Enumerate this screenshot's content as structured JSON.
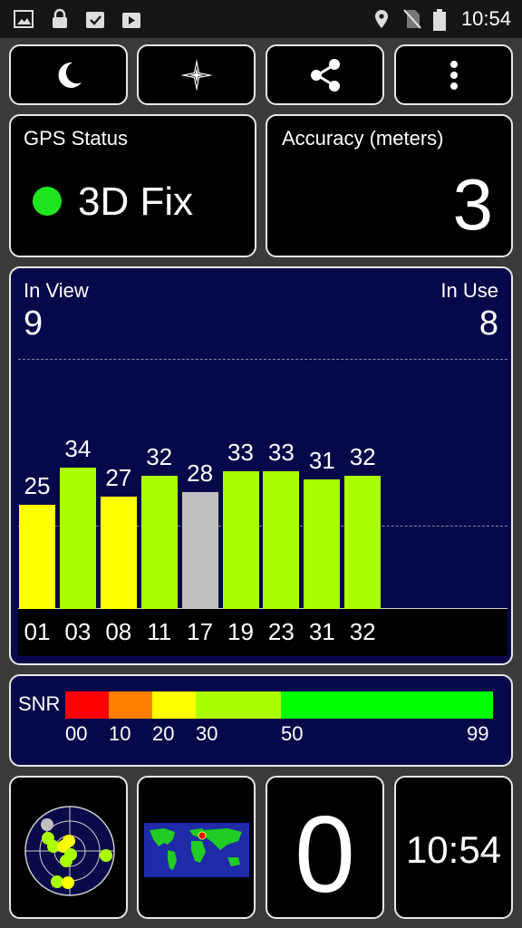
{
  "statusbar": {
    "time": "10:54",
    "icons": [
      "image-icon",
      "lock-icon",
      "clipboard-check-icon",
      "play-store-icon",
      "location-pin-icon",
      "no-sim-icon",
      "battery-icon"
    ]
  },
  "toolbar": {
    "buttons": [
      "moon-icon",
      "compass-star-icon",
      "share-icon",
      "more-vert-icon"
    ]
  },
  "gps_status": {
    "label": "GPS Status",
    "value": "3D Fix",
    "indicator_color": "#1ee51e"
  },
  "accuracy": {
    "label": "Accuracy (meters)",
    "value": "3"
  },
  "satellites": {
    "in_view_label": "In View",
    "in_view": "9",
    "in_use_label": "In Use",
    "in_use": "8"
  },
  "chart_data": {
    "type": "bar",
    "categories": [
      "01",
      "03",
      "08",
      "11",
      "17",
      "19",
      "23",
      "31",
      "32"
    ],
    "values": [
      25,
      34,
      27,
      32,
      28,
      33,
      33,
      31,
      32
    ],
    "colors": [
      "#ffff00",
      "#aaff00",
      "#ffff00",
      "#aaff00",
      "#c0c0c0",
      "#aaff00",
      "#aaff00",
      "#aaff00",
      "#aaff00"
    ],
    "ylim": [
      0,
      60
    ],
    "grid": true
  },
  "snr": {
    "label": "SNR",
    "ticks": [
      "00",
      "10",
      "20",
      "30",
      "50",
      "99"
    ],
    "colors": [
      "#ff0000",
      "#ff8000",
      "#ffff00",
      "#aaff00",
      "#00ff00"
    ]
  },
  "bottom": {
    "count": "0",
    "clock": "10:54"
  }
}
